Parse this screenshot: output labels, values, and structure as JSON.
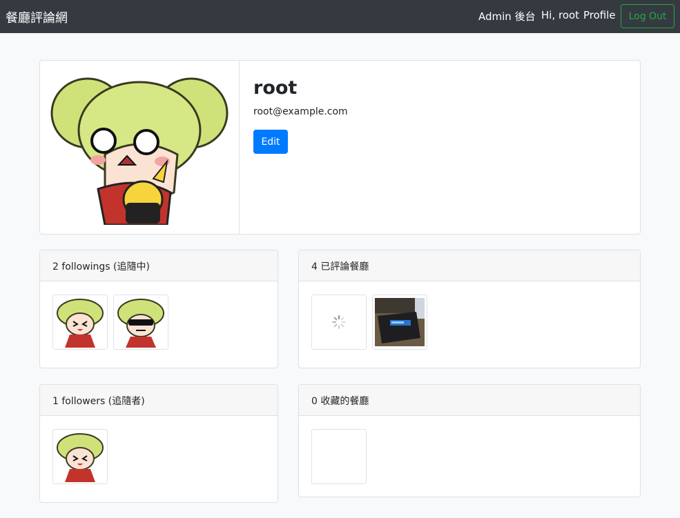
{
  "navbar": {
    "brand": "餐廳評論網",
    "admin_link": "Admin 後台",
    "greeting": "Hi, root",
    "profile_link": "Profile",
    "logout_label": "Log Out"
  },
  "profile": {
    "username": "root",
    "email": "root@example.com",
    "edit_label": "Edit"
  },
  "sections": {
    "followings": {
      "title": "2 followings (追隨中)"
    },
    "commented": {
      "title": "4 已評論餐廳"
    },
    "followers": {
      "title": "1 followers (追隨者)"
    },
    "favorited": {
      "title": "0 收藏的餐廳"
    }
  },
  "colors": {
    "navbar_bg": "#343a40",
    "primary": "#007bff",
    "success": "#28a745"
  }
}
